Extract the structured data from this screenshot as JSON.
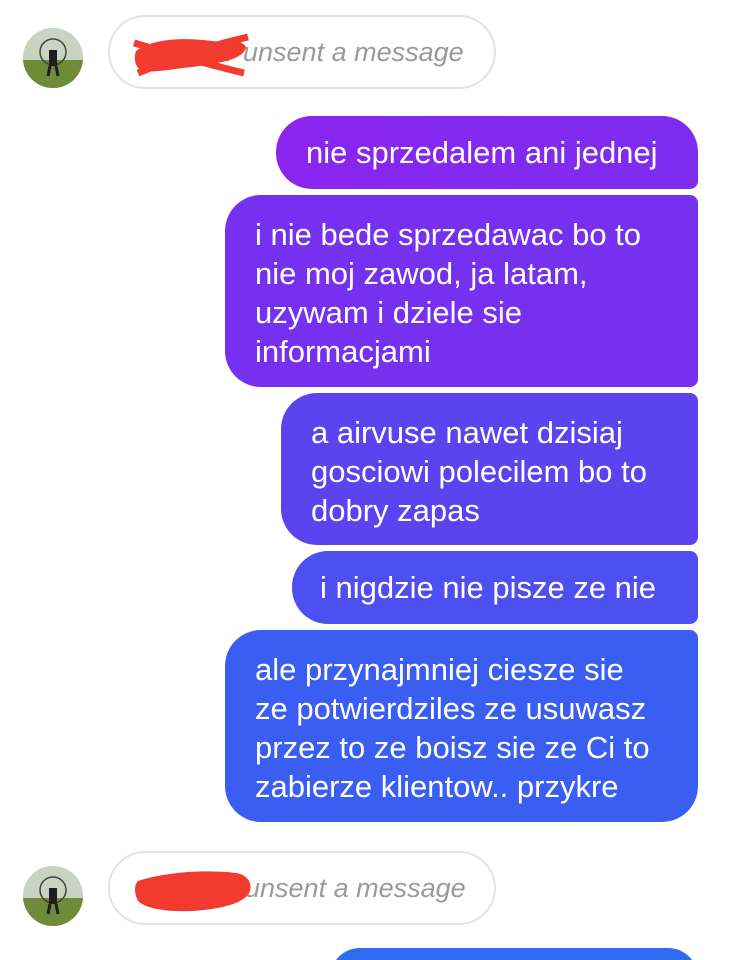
{
  "conversation": {
    "unsent_notice_1": "v unsent a message",
    "unsent_notice_2": "unsent a message",
    "messages": [
      "nie sprzedalem ani jednej",
      "i nie bede sprzedawac bo to\nnie moj zawod, ja latam,\nuzywam i dziele sie\ninformacjami",
      "a airvuse nawet dzisiaj\ngosciowi polecilem bo to\ndobry zapas",
      "i nigdzie nie pisze ze nie",
      "ale przynajmniej ciesze sie\nze potwierdziles ze usuwasz\nprzez to ze boisz sie ze Ci to\nzabierze klientow.. przykre"
    ]
  },
  "colors": {
    "bubble_top": "#8a25ef",
    "bubble_bottom": "#3a5df2",
    "redaction": "#f23a2e",
    "unsent_text": "#9a9a9a"
  }
}
